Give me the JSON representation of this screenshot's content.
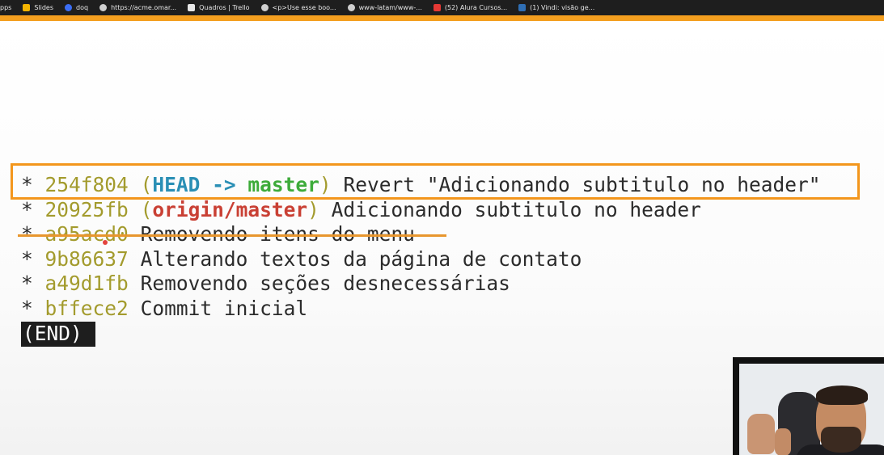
{
  "bookmarks": [
    {
      "label": "pps",
      "icon": "none"
    },
    {
      "label": "Slides",
      "icon": "slides-icon",
      "color": "#f4b400"
    },
    {
      "label": "doq",
      "icon": "doq-icon",
      "color": "#3b6ef5"
    },
    {
      "label": "https://acme.omar...",
      "icon": "globe-icon",
      "color": "#cfcfcf"
    },
    {
      "label": "Quadros | Trello",
      "icon": "trello-icon",
      "color": "#e8e8e8"
    },
    {
      "label": "<p>Use esse boo...",
      "icon": "globe-icon",
      "color": "#cfcfcf"
    },
    {
      "label": "www-latam/www-...",
      "icon": "github-icon",
      "color": "#cfcfcf"
    },
    {
      "label": "(52) Alura Cursos...",
      "icon": "youtube-icon",
      "color": "#e53935"
    },
    {
      "label": "(1) Vindi: visão ge...",
      "icon": "linkedin-icon",
      "color": "#2f6fb5"
    }
  ],
  "git_log": {
    "commits": [
      {
        "hash": "254f804",
        "message": "Revert \"Adicionando subtitulo no header\"",
        "ref_head": "HEAD",
        "ref_arrow": "->",
        "ref_branch": "master"
      },
      {
        "hash": "20925fb",
        "message": "Adicionando subtitulo no header",
        "ref_remote": "origin/master"
      },
      {
        "hash": "a95acd0",
        "message": "Removendo itens do menu"
      },
      {
        "hash": "9b86637",
        "message": "Alterando textos da página de contato"
      },
      {
        "hash": "a49d1fb",
        "message": "Removendo seções desnecessárias"
      },
      {
        "hash": "bffece2",
        "message": "Commit inicial"
      }
    ],
    "bullet": "*",
    "end_marker": "(END)"
  },
  "colors": {
    "highlight": "#f3961c",
    "hash": "#a39b2d",
    "head": "#2a8fb5",
    "master": "#3dab3a",
    "origin": "#c94034"
  }
}
